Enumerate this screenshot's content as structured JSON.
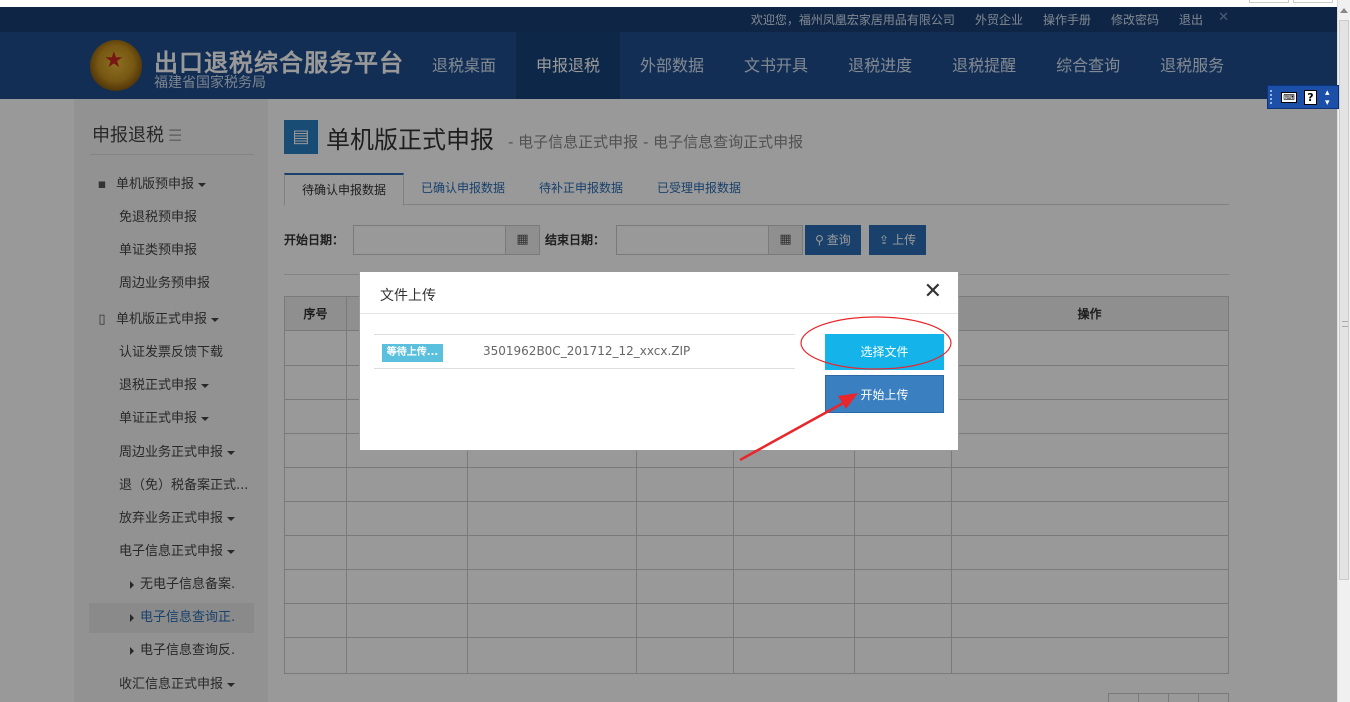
{
  "header": {
    "userbar_links": [
      "欢迎您，福州凤凰宏家居用品有限公司",
      "外贸企业",
      "操作手册",
      "修改密码",
      "退出"
    ],
    "userbar_close": "✕",
    "title": "出口退税综合服务平台",
    "subtitle": "福建省国家税务局",
    "nav": [
      "退税桌面",
      "申报退税",
      "外部数据",
      "文书开具",
      "退税进度",
      "退税提醒",
      "综合查询",
      "退税服务"
    ],
    "nav_active_index": 1
  },
  "sidebar": {
    "title": "申报退税",
    "items": [
      {
        "label": "单机版预申报",
        "level": "group",
        "icon": "briefcase-icon",
        "caret": true
      },
      {
        "label": "免退税预申报",
        "level": "sub"
      },
      {
        "label": "单证类预申报",
        "level": "sub"
      },
      {
        "label": "周边业务预申报",
        "level": "sub"
      },
      {
        "label": "单机版正式申报",
        "level": "group",
        "icon": "document-icon",
        "caret": true
      },
      {
        "label": "认证发票反馈下载",
        "level": "sub"
      },
      {
        "label": "退税正式申报",
        "level": "sub",
        "caret": true
      },
      {
        "label": "单证正式申报",
        "level": "sub",
        "caret": true
      },
      {
        "label": "周边业务正式申报",
        "level": "sub",
        "caret": true
      },
      {
        "label": "退（免）税备案正式...",
        "level": "sub"
      },
      {
        "label": "放弃业务正式申报",
        "level": "sub",
        "caret": true
      },
      {
        "label": "电子信息正式申报",
        "level": "sub",
        "caret": true
      },
      {
        "label": "无电子信息备案.",
        "level": "subsub"
      },
      {
        "label": "电子信息查询正.",
        "level": "subsub",
        "selected": true
      },
      {
        "label": "电子信息查询反.",
        "level": "subsub"
      },
      {
        "label": "收汇信息正式申报",
        "level": "sub",
        "caret": true
      }
    ]
  },
  "page": {
    "title": "单机版正式申报",
    "breadcrumb": "- 电子信息正式申报 - 电子信息查询正式申报",
    "tabs": [
      "待确认申报数据",
      "已确认申报数据",
      "待补正申报数据",
      "已受理申报数据"
    ],
    "active_tab": 0,
    "filter": {
      "start_label": "开始日期：",
      "start_value": "",
      "end_label": "结束日期：",
      "end_value": "",
      "query_button": "查询",
      "upload_button": "上传"
    },
    "table": {
      "headers": [
        "序号",
        "操作"
      ]
    }
  },
  "dialog": {
    "title": "文件上传",
    "close": "✕",
    "file_status": "等待上传...",
    "file_name": "3501962B0C_201712_12_xxcx.ZIP",
    "choose_button": "选择文件",
    "start_button": "开始上传"
  },
  "annotations": {
    "color": "#e8262b"
  }
}
